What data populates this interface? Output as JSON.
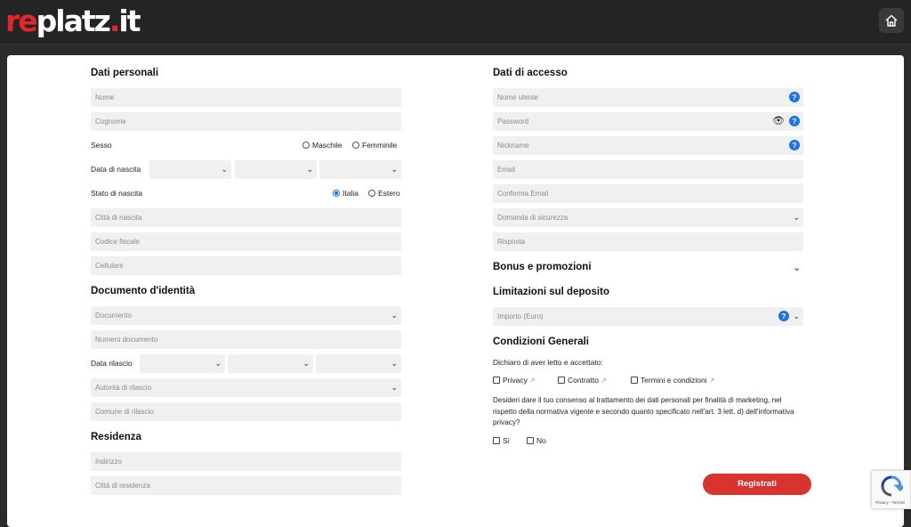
{
  "header": {
    "logo": {
      "re": "re",
      "platz": "platz",
      "dot": ".",
      "it": "it"
    },
    "home_icon": "home-icon"
  },
  "personal": {
    "title": "Dati personali",
    "nome_placeholder": "Nome",
    "cognome_placeholder": "Cognome",
    "sesso_label": "Sesso",
    "sesso_options": [
      "Maschile",
      "Femminile"
    ],
    "nascita_label": "Data di nascita",
    "stato_label": "Stato di nascita",
    "stato_options": [
      "Italia",
      "Estero"
    ],
    "stato_selected": "Italia",
    "citta_placeholder": "Città di nascita",
    "codice_placeholder": "Codice fiscale",
    "cellulare_placeholder": "Cellulare"
  },
  "document": {
    "title": "Documento d'identità",
    "documento_placeholder": "Documento",
    "numero_placeholder": "Numero documento",
    "rilascio_label": "Data rilascio",
    "autorita_placeholder": "Autorità di rilascio",
    "comune_placeholder": "Comune di rilascio"
  },
  "residence": {
    "title": "Residenza",
    "indirizzo_placeholder": "Indirizzo",
    "citta_placeholder": "Città di residenza"
  },
  "access": {
    "title": "Dati di accesso",
    "username_placeholder": "Nome utente",
    "password_placeholder": "Password",
    "nickname_placeholder": "Nickname",
    "email_placeholder": "Email",
    "conferma_placeholder": "Conferma Email",
    "domanda_placeholder": "Domanda di sicurezza",
    "risposta_placeholder": "Risposta"
  },
  "bonus": {
    "title": "Bonus e promozioni"
  },
  "limits": {
    "title": "Limitazioni sul deposito",
    "importo_placeholder": "Importo (Euro)"
  },
  "conditions": {
    "title": "Condizioni Generali",
    "intro": "Dichiaro di aver letto e accettato:",
    "checks": [
      "Privacy",
      "Contratto",
      "Termini e condizioni"
    ],
    "consent_text": "Desideri dare il tuo consenso al trattamento dei dati personali per finalità di marketing, nel rispetto della normativa vigente e secondo quanto specificato nell'art. 3 lett. d) dell'informativa privacy?",
    "consent_options": [
      "Sì",
      "No"
    ]
  },
  "submit_label": "Registrati",
  "recaptcha": {
    "text": "Privacy - Termini"
  },
  "colors": {
    "accent": "#d9332e",
    "help": "#1a73e8",
    "field_bg": "#f0f0f0"
  }
}
